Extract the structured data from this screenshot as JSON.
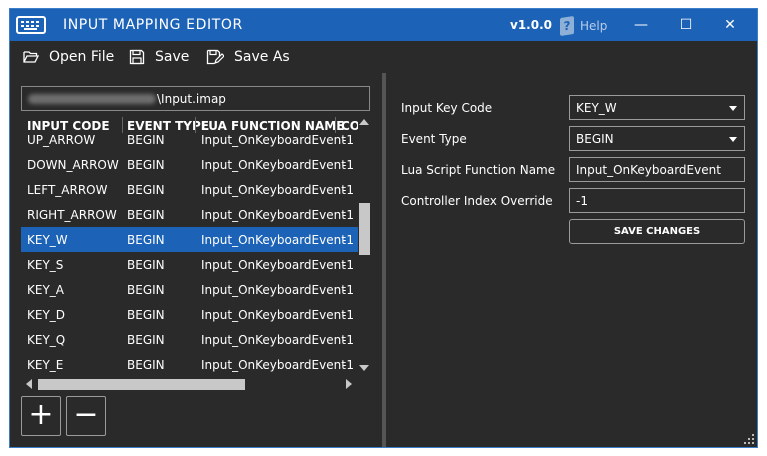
{
  "window": {
    "title": "INPUT MAPPING EDITOR",
    "version": "v1.0.0",
    "help_label": "Help",
    "minimize_glyph": "—",
    "maximize_glyph": "☐",
    "close_glyph": "✕"
  },
  "toolbar": {
    "open_file_label": "Open File",
    "save_label": "Save",
    "save_as_label": "Save As"
  },
  "file_path": {
    "visible_text": "\\Input.imap"
  },
  "grid": {
    "columns": [
      "INPUT CODE",
      "EVENT TYPE",
      "LUA FUNCTION NAME",
      "CO"
    ],
    "rows": [
      {
        "code": "UP_ARROW",
        "event": "BEGIN",
        "func": "Input_OnKeyboardEvent",
        "ctrl": "-1"
      },
      {
        "code": "DOWN_ARROW",
        "event": "BEGIN",
        "func": "Input_OnKeyboardEvent",
        "ctrl": "-1"
      },
      {
        "code": "LEFT_ARROW",
        "event": "BEGIN",
        "func": "Input_OnKeyboardEvent",
        "ctrl": "-1"
      },
      {
        "code": "RIGHT_ARROW",
        "event": "BEGIN",
        "func": "Input_OnKeyboardEvent",
        "ctrl": "-1"
      },
      {
        "code": "KEY_W",
        "event": "BEGIN",
        "func": "Input_OnKeyboardEvent",
        "ctrl": "-1"
      },
      {
        "code": "KEY_S",
        "event": "BEGIN",
        "func": "Input_OnKeyboardEvent",
        "ctrl": "-1"
      },
      {
        "code": "KEY_A",
        "event": "BEGIN",
        "func": "Input_OnKeyboardEvent",
        "ctrl": "-1"
      },
      {
        "code": "KEY_D",
        "event": "BEGIN",
        "func": "Input_OnKeyboardEvent",
        "ctrl": "-1"
      },
      {
        "code": "KEY_Q",
        "event": "BEGIN",
        "func": "Input_OnKeyboardEvent",
        "ctrl": "-1"
      },
      {
        "code": "KEY_E",
        "event": "BEGIN",
        "func": "Input_OnKeyboardEvent",
        "ctrl": "-1"
      }
    ],
    "selected_code": "KEY_W"
  },
  "list_buttons": {
    "add_glyph": "+",
    "remove_glyph": "−"
  },
  "form": {
    "input_key_code_label": "Input Key Code",
    "input_key_code_value": "KEY_W",
    "event_type_label": "Event Type",
    "event_type_value": "BEGIN",
    "lua_function_label": "Lua Script Function Name",
    "lua_function_value": "Input_OnKeyboardEvent",
    "controller_index_label": "Controller Index Override",
    "controller_index_value": "-1",
    "save_changes_label": "SAVE CHANGES"
  },
  "colors": {
    "titlebar": "#1c63b7",
    "background": "#2a2a2a",
    "selection": "#1c63b7",
    "text": "#ffffff"
  },
  "icons": [
    "keyboard-icon",
    "help-icon",
    "folder-open-icon",
    "save-icon",
    "save-as-icon"
  ]
}
